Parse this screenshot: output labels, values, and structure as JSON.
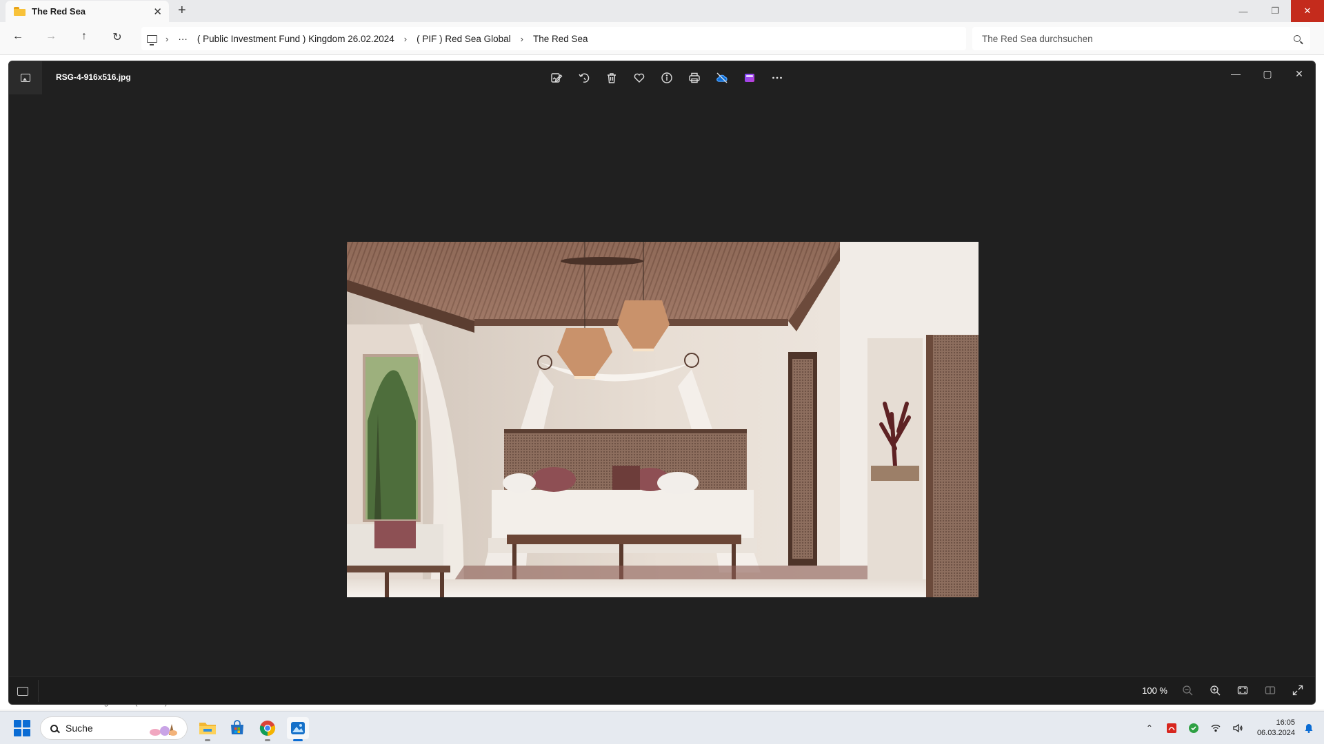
{
  "explorer": {
    "tab_title": "The Red Sea",
    "new_tab_symbol": "+",
    "tab_close_symbol": "✕",
    "breadcrumb": [
      "( Public Investment Fund ) Kingdom 26.02.2024",
      "( PIF ) Red Sea Global",
      "The Red Sea"
    ],
    "breadcrumb_overflow": "···",
    "search_placeholder": "The Red Sea durchsuchen",
    "status_text": "Elemente    1 Element ausgewählt (144 KB)"
  },
  "photos": {
    "file_name": "RSG-4-916x516.jpg",
    "toolbar": [
      {
        "name": "edit-image",
        "icon": "edit-icon"
      },
      {
        "name": "rotate",
        "icon": "rotate-icon"
      },
      {
        "name": "delete",
        "icon": "trash-icon"
      },
      {
        "name": "favorite",
        "icon": "heart-icon"
      },
      {
        "name": "file-info",
        "icon": "info-icon"
      },
      {
        "name": "print",
        "icon": "printer-icon"
      },
      {
        "name": "onedrive-off",
        "icon": "cloud-off-icon"
      },
      {
        "name": "clipchamp",
        "icon": "clipchamp-icon"
      },
      {
        "name": "more",
        "icon": "more-icon"
      }
    ],
    "zoom_level": "100 %"
  },
  "taskbar": {
    "search_label": "Suche",
    "time": "16:05",
    "date": "06.03.2024"
  },
  "colors": {
    "close_red": "#c42b1c",
    "accent_blue": "#0a6cd4",
    "viewer_bg": "#202020"
  }
}
